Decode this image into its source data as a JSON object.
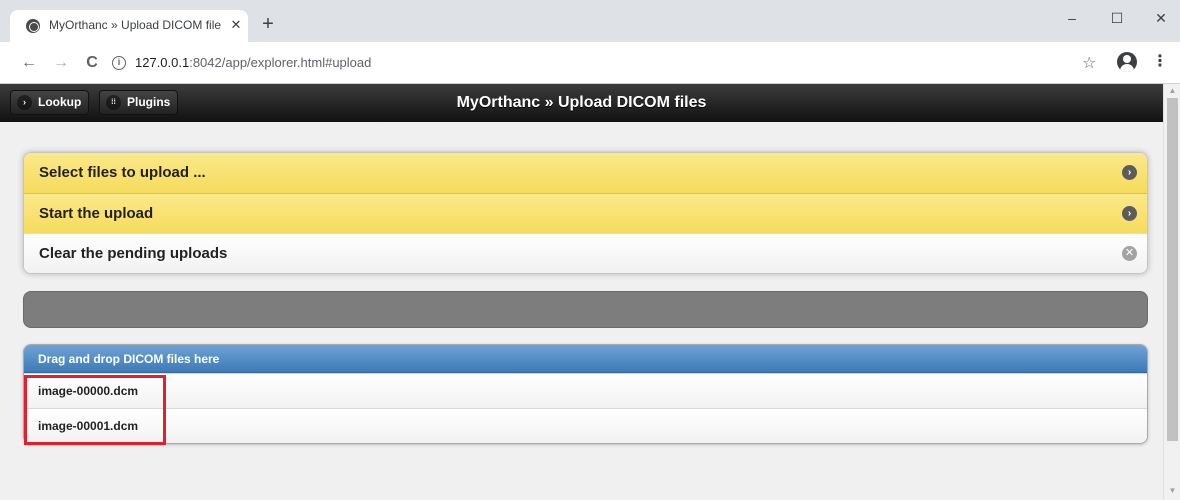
{
  "browser": {
    "tab_title": "MyOrthanc » Upload DICOM files",
    "tab_close": "✕",
    "new_tab": "+",
    "url_host": "127.0.0.1",
    "url_rest": ":8042/app/explorer.html#upload",
    "icons": {
      "back": "←",
      "forward": "→",
      "reload": "C",
      "info": "i",
      "star": "☆",
      "menu": "⋮",
      "minimize": "–",
      "maximize": "☐",
      "close": "✕"
    }
  },
  "header": {
    "lookup_label": "Lookup",
    "plugins_label": "Plugins",
    "lookup_icon": "›",
    "plugins_icon": "⁞⁞",
    "title": "MyOrthanc » Upload DICOM files"
  },
  "actions": {
    "select_files": "Select files to upload ...",
    "start_upload": "Start the upload",
    "clear_pending": "Clear the pending uploads",
    "go_icon": "›",
    "clear_icon": "✕"
  },
  "upload_progress": 0,
  "drop_zone": {
    "header": "Drag and drop DICOM files here",
    "files": [
      "image-00000.dcm",
      "image-00001.dcm"
    ]
  },
  "scrollbar": {
    "up_icon": "▲",
    "down_icon": "▼"
  },
  "colors": {
    "header_bg": "#1c1c1c",
    "yellow_row": "#f8e06f",
    "progress_bg": "#7d7d7d",
    "drop_header": "#4f8ac4",
    "highlight": "#e0202a"
  }
}
